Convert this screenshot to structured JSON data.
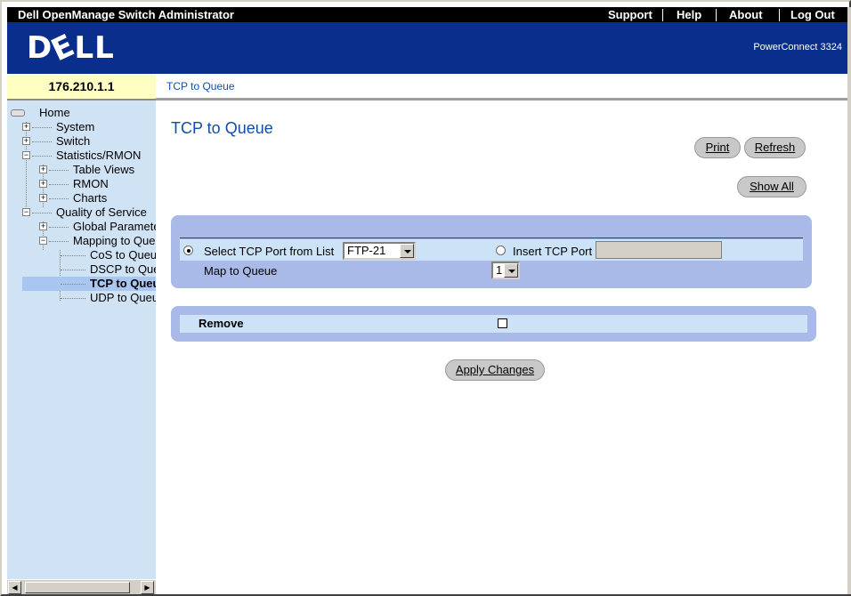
{
  "header": {
    "app_title": "Dell OpenManage Switch Administrator",
    "links": [
      "Support",
      "Help",
      "About",
      "Log Out"
    ]
  },
  "banner": {
    "logo_text": "DELL",
    "model": "PowerConnect 3324"
  },
  "device_ip": "176.210.1.1",
  "breadcrumb": "TCP to Queue",
  "sidebar": {
    "home": "Home",
    "system": "System",
    "switch": "Switch",
    "statistics": "Statistics/RMON",
    "table_views": "Table Views",
    "rmon": "RMON",
    "charts": "Charts",
    "qos": "Quality of Service",
    "global_params": "Global Parameters",
    "mapping": "Mapping to Queue",
    "cos": "CoS to Queue",
    "dscp": "DSCP to Queue",
    "tcp": "TCP to Queue",
    "udp": "UDP to Queue",
    "selected": "TCP to Queue"
  },
  "main": {
    "title": "TCP to Queue",
    "print_label": "Print",
    "refresh_label": "Refresh",
    "show_all_label": "Show All",
    "select_port_label": "Select TCP Port from List",
    "select_port_value": "FTP-21",
    "select_port_checked": true,
    "insert_port_label": "Insert TCP Port",
    "insert_port_value": "",
    "map_queue_label": "Map to Queue",
    "map_queue_value": "1",
    "remove_label": "Remove",
    "remove_checked": false,
    "apply_label": "Apply Changes"
  },
  "colors": {
    "topbar": "#000000",
    "banner": "#0a2e8c",
    "title_blue": "#0f4fa8",
    "sidebar_bg": "#cfe3f5",
    "ip_box": "#ffffc4",
    "panel_bg": "#a9b9e8",
    "panel_row": "#cce2f7",
    "selected_node": "#a9c6f0"
  }
}
